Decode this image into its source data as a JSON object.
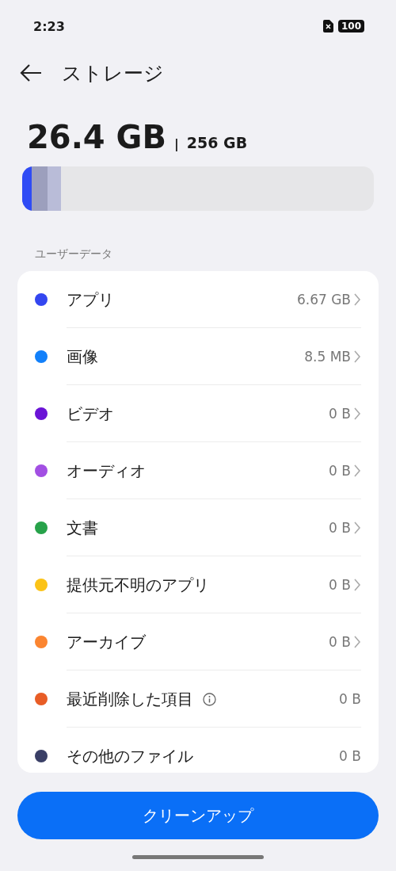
{
  "status_bar": {
    "time": "2:23",
    "battery": "100"
  },
  "header": {
    "title": "ストレージ"
  },
  "summary": {
    "used": "26.4 GB",
    "separator": "|",
    "total": "256 GB"
  },
  "usage_bar": {
    "segments": [
      {
        "color": "#2f4bf5",
        "level": 0.027
      },
      {
        "color": "#9c9fbd",
        "level": 0.045
      },
      {
        "color": "#b9bcd8",
        "level": 0.038
      }
    ]
  },
  "section_label": "ユーザーデータ",
  "categories": [
    {
      "name": "アプリ",
      "size": "6.67 GB",
      "color": "#3346f0",
      "chevron": true,
      "info": false
    },
    {
      "name": "画像",
      "size": "8.5 MB",
      "color": "#1280fa",
      "chevron": true,
      "info": false
    },
    {
      "name": "ビデオ",
      "size": "0 B",
      "color": "#6a13d6",
      "chevron": true,
      "info": false
    },
    {
      "name": "オーディオ",
      "size": "0 B",
      "color": "#a24fe3",
      "chevron": true,
      "info": false
    },
    {
      "name": "文書",
      "size": "0 B",
      "color": "#27a24a",
      "chevron": true,
      "info": false
    },
    {
      "name": "提供元不明のアプリ",
      "size": "0 B",
      "color": "#fbc317",
      "chevron": true,
      "info": false
    },
    {
      "name": "アーカイブ",
      "size": "0 B",
      "color": "#fb8530",
      "chevron": true,
      "info": false
    },
    {
      "name": "最近削除した項目",
      "size": "0 B",
      "color": "#e85d26",
      "chevron": false,
      "info": true
    },
    {
      "name": "その他のファイル",
      "size": "0 B",
      "color": "#3a3f66",
      "chevron": false,
      "info": false
    }
  ],
  "action_button": "クリーンアップ"
}
